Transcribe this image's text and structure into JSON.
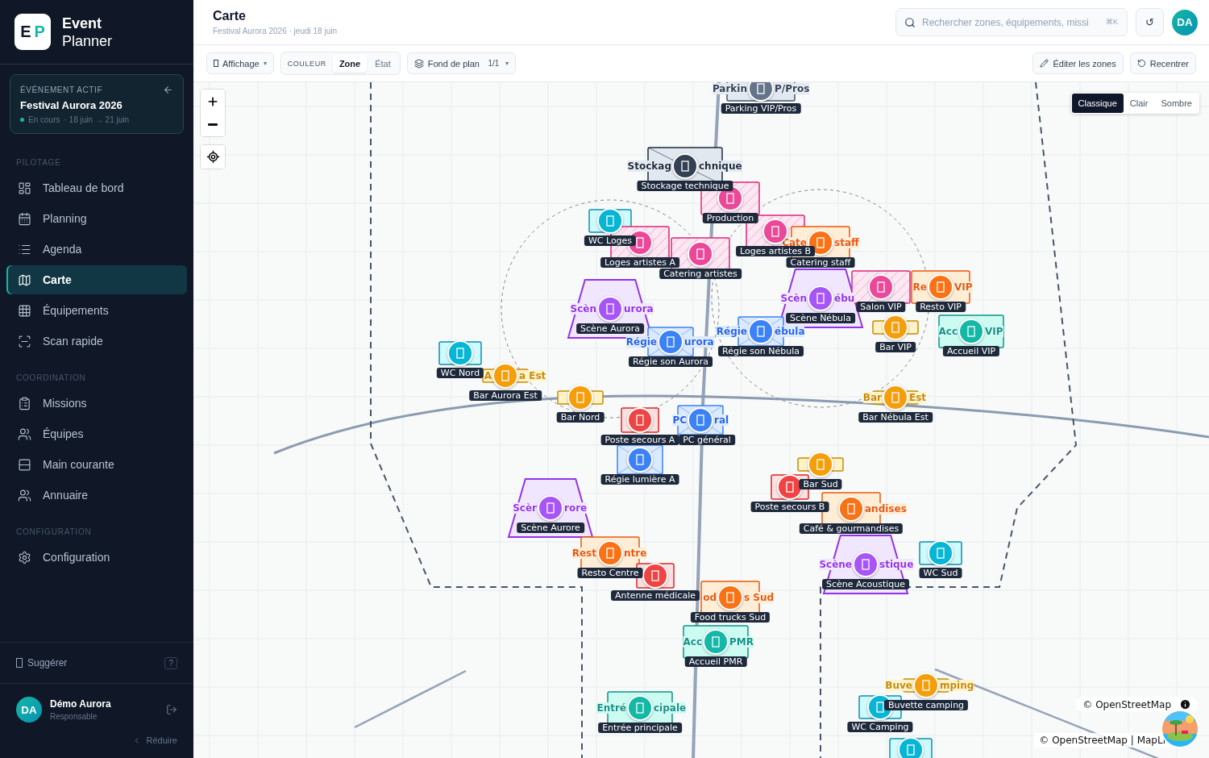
{
  "app": {
    "logo": [
      "E",
      "P"
    ],
    "name": [
      "Event",
      "Planner"
    ]
  },
  "active_event": {
    "caption": "ÉVÉNEMENT ACTIF",
    "name": "Festival Aurora 2026",
    "status": "En cours",
    "dates": "· 18 juin → 21 juin"
  },
  "nav": [
    {
      "title": "PILOTAGE",
      "items": [
        {
          "label": "Tableau de bord",
          "selected": false
        },
        {
          "label": "Planning",
          "selected": false
        },
        {
          "label": "Agenda",
          "selected": false
        },
        {
          "label": "Carte",
          "selected": true
        },
        {
          "label": "Équipements",
          "selected": false
        },
        {
          "label": "Scan rapide",
          "selected": false
        }
      ]
    },
    {
      "title": "COORDINATION",
      "items": [
        {
          "label": "Missions",
          "selected": false
        },
        {
          "label": "Équipes",
          "selected": false
        },
        {
          "label": "Main courante",
          "selected": false
        },
        {
          "label": "Annuaire",
          "selected": false
        }
      ]
    },
    {
      "title": "CONFIGURATION",
      "items": [
        {
          "label": "Configuration",
          "selected": false
        }
      ]
    }
  ],
  "suggest": {
    "label": "Suggérer",
    "hint": "?"
  },
  "user": {
    "initials": "DA",
    "name": "Démo Aurora",
    "role": "Responsable"
  },
  "collapse": "Réduire",
  "header": {
    "title": "Carte",
    "subtitle": "Festival Aurora 2026 · jeudi 18 juin",
    "search": {
      "placeholder": "Rechercher zones, équipements, missi",
      "shortcut": "⌘K"
    },
    "refresh": "↺",
    "avatar": "DA"
  },
  "toolbar": {
    "display": {
      "label": "Affichage",
      "caret": "▾"
    },
    "color_by": {
      "caption": "COULEUR",
      "options": [
        {
          "label": "Zone",
          "selected": true
        },
        {
          "label": "État",
          "selected": false
        }
      ]
    },
    "basemap": {
      "label": "Fond de plan",
      "count": "1/1",
      "caret": "▾"
    },
    "actions": [
      "Éditer les zones",
      "Recentrer"
    ]
  },
  "map": {
    "styles": [
      {
        "label": "Classique",
        "selected": true
      },
      {
        "label": "Clair",
        "selected": false
      },
      {
        "label": "Sombre",
        "selected": false
      }
    ],
    "zones": [
      {
        "kind": "parking",
        "label": "Parking VIP/Pros",
        "name_left": "Parkin",
        "name_right": "P/Pros"
      },
      {
        "kind": "storage",
        "label": "Stockage technique",
        "name_left": "Stockag",
        "name_right": "chnique"
      },
      {
        "kind": "backstage",
        "label": "Production"
      },
      {
        "kind": "wc",
        "label": "WC Loges"
      },
      {
        "kind": "backstage",
        "label": "Loges artistes A"
      },
      {
        "kind": "backstage",
        "label": "Catering artistes"
      },
      {
        "kind": "backstage",
        "label": "Loges artistes B"
      },
      {
        "kind": "food",
        "label": "Catering staff",
        "name_left": "Cate",
        "name_right": "staff"
      },
      {
        "kind": "stage",
        "label": "Scène Aurora",
        "name_left": "Scèn",
        "name_right": "urora"
      },
      {
        "kind": "stage",
        "label": "Scène Nébula",
        "name_left": "Scèn",
        "name_right": "ébu"
      },
      {
        "kind": "backstage",
        "label": "Salon VIP"
      },
      {
        "kind": "food",
        "label": "Resto VIP",
        "name_left": "Re",
        "name_right": "VIP"
      },
      {
        "kind": "bar",
        "label": "Bar VIP"
      },
      {
        "kind": "welcome",
        "label": "Accueil VIP",
        "name_left": "Acc",
        "name_right": "VIP"
      },
      {
        "kind": "tech",
        "label": "Régie son Aurora",
        "name_left": "Régie",
        "name_right": "urora"
      },
      {
        "kind": "tech",
        "label": "Régie son Nébula",
        "name_left": "Régie",
        "name_right": "ébula"
      },
      {
        "kind": "wc",
        "label": "WC Nord"
      },
      {
        "kind": "bar",
        "label": "Bar Aurora Est",
        "name_left": "A",
        "name_right": "a Est"
      },
      {
        "kind": "bar",
        "label": "Bar Nord"
      },
      {
        "kind": "medical",
        "label": "Poste secours A"
      },
      {
        "kind": "tech",
        "label": "Régie lumière A"
      },
      {
        "kind": "tech",
        "label": "PC général",
        "name_left": "PC",
        "name_right": "ral"
      },
      {
        "kind": "bar",
        "label": "Bar Nébula Est",
        "name_left": "Bar",
        "name_right": "Est"
      },
      {
        "kind": "bar",
        "label": "Bar Sud"
      },
      {
        "kind": "stage",
        "label": "Scène Aurore",
        "name_left": "Scèr",
        "name_right": "rore"
      },
      {
        "kind": "medical",
        "label": "Poste secours B"
      },
      {
        "kind": "food",
        "label": "Café & gourmandises",
        "name_right": "andises"
      },
      {
        "kind": "food",
        "label": "Resto Centre",
        "name_left": "Rest",
        "name_right": "ntre"
      },
      {
        "kind": "medical",
        "label": "Antenne médicale"
      },
      {
        "kind": "stage",
        "label": "Scène Acoustique",
        "name_left": "Scène",
        "name_right": "stique"
      },
      {
        "kind": "wc",
        "label": "WC Sud"
      },
      {
        "kind": "food",
        "label": "Food trucks Sud",
        "name_left": "od",
        "name_right": "s Sud"
      },
      {
        "kind": "welcome",
        "label": "Accueil PMR",
        "name_left": "Acc",
        "name_right": "PMR"
      },
      {
        "kind": "welcome",
        "label": "Entrée principale",
        "name_left": "Entré",
        "name_right": "cipale"
      },
      {
        "kind": "wc",
        "label": "WC Camping"
      },
      {
        "kind": "bar",
        "label": "Buvette camping",
        "name_left": "Buve",
        "name_right": "mping"
      },
      {
        "kind": "wc"
      }
    ],
    "attribution": "© OpenStreetMap",
    "attribution_bar": "© OpenStreetMap | MapLi"
  }
}
